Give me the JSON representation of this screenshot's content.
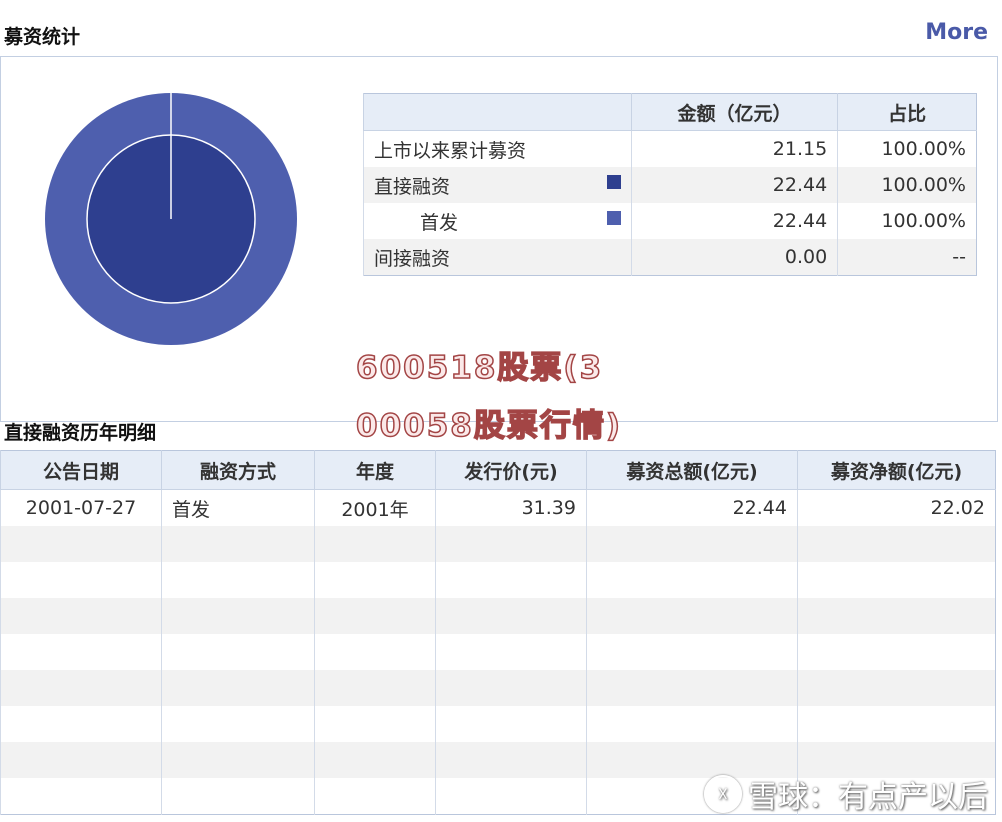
{
  "header": {
    "title": "募资统计",
    "more_label": "More"
  },
  "summary": {
    "columns": [
      "",
      "金额（亿元）",
      "占比"
    ],
    "rows": [
      {
        "label": "上市以来累计募资",
        "amount": "21.15",
        "ratio": "100.00%"
      },
      {
        "label": "直接融资",
        "amount": "22.44",
        "ratio": "100.00%",
        "swatch": "#2e3f8f"
      },
      {
        "label": "首发",
        "amount": "22.44",
        "ratio": "100.00%",
        "swatch": "#4e5fae"
      },
      {
        "label": "间接融资",
        "amount": "0.00",
        "ratio": "--"
      }
    ]
  },
  "chart_data": {
    "type": "pie",
    "rings": [
      {
        "name": "直接融资",
        "values": [
          22.44,
          0
        ],
        "color": "#2e3f8f"
      },
      {
        "name": "首发",
        "values": [
          22.44,
          0
        ],
        "color": "#4e5fae"
      }
    ]
  },
  "watermark": {
    "line1": "600518股票(3",
    "line2": "00058股票行情)"
  },
  "detail": {
    "title": "直接融资历年明细",
    "columns": [
      "公告日期",
      "融资方式",
      "年度",
      "发行价(元)",
      "募资总额(亿元)",
      "募资净额(亿元)"
    ],
    "rows": [
      {
        "date": "2001-07-27",
        "method": "首发",
        "year": "2001年",
        "price": "31.39",
        "total": "22.44",
        "net": "22.02"
      }
    ]
  },
  "footer": {
    "source": "雪球：有点产以后"
  },
  "colors": {
    "accent": "#4a5aa8",
    "inner": "#2e3f8f",
    "outer": "#4e5fae"
  }
}
